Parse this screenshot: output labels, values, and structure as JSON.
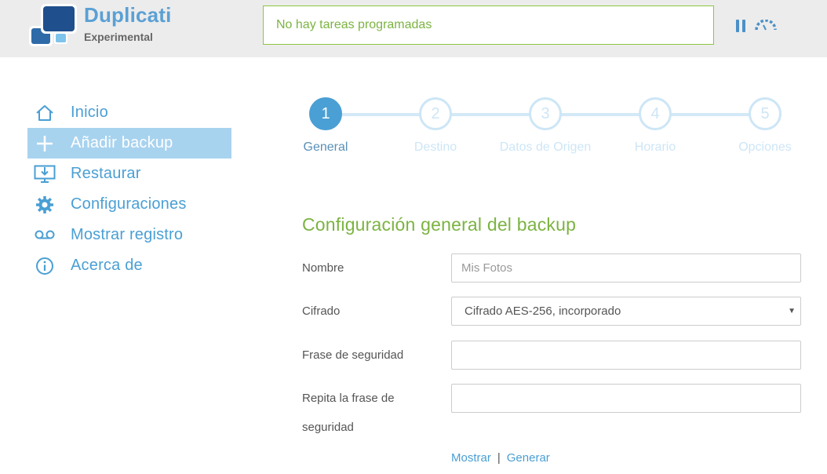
{
  "header": {
    "brand_name": "Duplicati",
    "brand_sub": "Experimental",
    "status_text": "No hay tareas programadas",
    "pause_icon": "pause-icon",
    "throttle_icon": "throttle-icon"
  },
  "colors": {
    "accent": "#4a9fd4",
    "active_nav_bg": "#a8d3ef",
    "green": "#7cb342",
    "header_bg": "#ececec"
  },
  "sidebar": {
    "items": [
      {
        "label": "Inicio",
        "icon": "home-icon",
        "active": false
      },
      {
        "label": "Añadir backup",
        "icon": "plus-icon",
        "active": true
      },
      {
        "label": "Restaurar",
        "icon": "restore-icon",
        "active": false
      },
      {
        "label": "Configuraciones",
        "icon": "gear-icon",
        "active": false
      },
      {
        "label": "Mostrar registro",
        "icon": "log-icon",
        "active": false
      },
      {
        "label": "Acerca de",
        "icon": "info-icon",
        "active": false
      }
    ]
  },
  "steps": [
    {
      "number": "1",
      "label": "General",
      "active": true
    },
    {
      "number": "2",
      "label": "Destino",
      "active": false
    },
    {
      "number": "3",
      "label": "Datos de Origen",
      "active": false
    },
    {
      "number": "4",
      "label": "Horario",
      "active": false
    },
    {
      "number": "5",
      "label": "Opciones",
      "active": false
    }
  ],
  "form": {
    "title": "Configuración general del backup",
    "name_label": "Nombre",
    "name_placeholder": "Mis Fotos",
    "name_value": "",
    "encryption_label": "Cifrado",
    "encryption_value": "Cifrado AES-256, incorporado",
    "passphrase_label": "Frase de seguridad",
    "passphrase_value": "",
    "repeat_label_line1": "Repita la frase de",
    "repeat_label_line2": "seguridad",
    "repeat_value": "",
    "show_link": "Mostrar",
    "link_separator": "|",
    "generate_link": "Generar"
  }
}
